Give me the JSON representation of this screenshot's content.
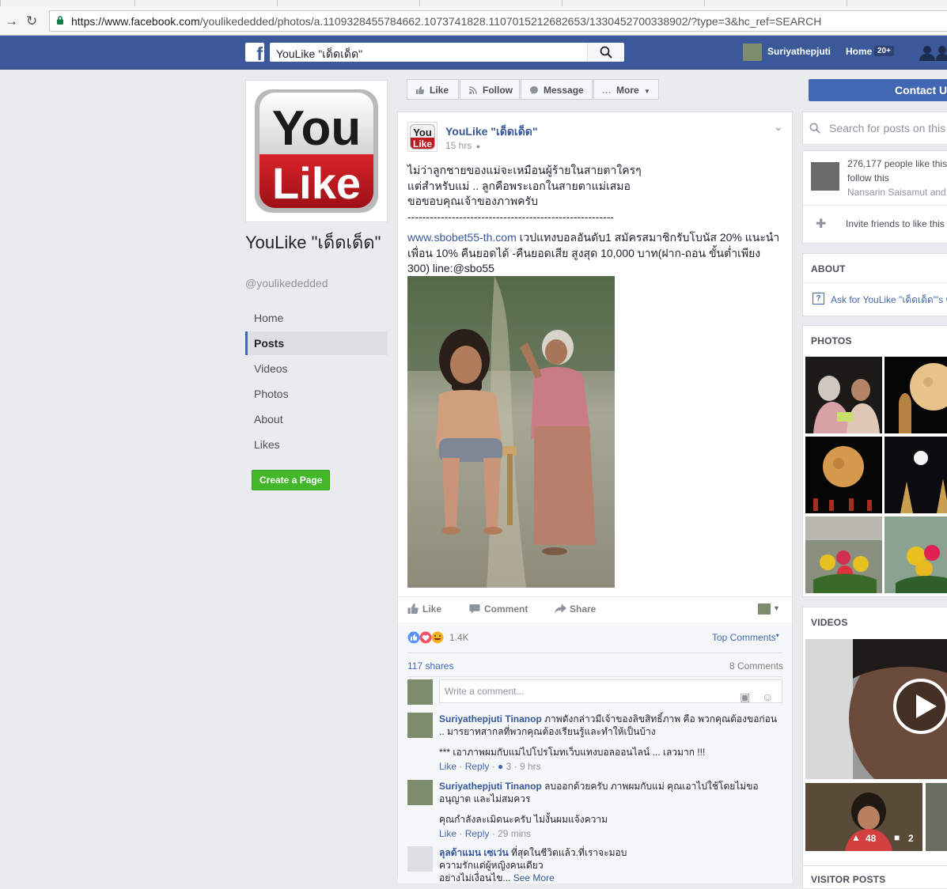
{
  "browser": {
    "url_host": "https://www.facebook.com",
    "url_path": "/youlikededded/photos/a.1109328455784662.1073741828.1107015212682653/1330452700338902/?type=3&hc_ref=SEARCH"
  },
  "topbar": {
    "search_value": "YouLike \"เด็ดเด็ด\"",
    "user_name": "Suriyathepjuti",
    "home_label": "Home",
    "home_badge": "20+"
  },
  "page": {
    "name": "YouLike \"เด็ดเด็ด\"",
    "handle": "@youlikededded",
    "logo_line1": "You",
    "logo_line2": "Like",
    "nav": [
      "Home",
      "Posts",
      "Videos",
      "Photos",
      "About",
      "Likes"
    ],
    "active_nav": "Posts",
    "create_page_label": "Create a Page"
  },
  "actions": {
    "like": "Like",
    "follow": "Follow",
    "message": "Message",
    "more": "More",
    "contact": "Contact Us"
  },
  "post": {
    "author": "YouLike \"เด็ดเด็ด\"",
    "time": "15 hrs",
    "text_lines": [
      "ไม่ว่าลูกชายของแม่จะเหมือนผู้ร้ายในสายตาใครๆ",
      "แต่สำหรับแม่ .. ลูกคือพระเอกในสายตาแม่เสมอ",
      "ขอขอบคุณเจ้าของภาพครับ",
      "--------------------------------------------------------"
    ],
    "link": "www.sbobet55-th.com",
    "promo_1": " เวปแทงบอลอันดับ1 สมัครสมาชิกรับโบนัส 20% แนะนำ",
    "promo_2": "เพื่อน 10% คืนยอดได้ -คืนยอดเสีย สูงสุด 10,000 บาท(ฝาก-ถอน ขั้นต่ำเพียง",
    "promo_3": "300) line:@sbo55",
    "buttons": {
      "like": "Like",
      "comment": "Comment",
      "share": "Share"
    },
    "reaction_count": "1.4K",
    "top_comments": "Top Comments",
    "shares": "117 shares",
    "comments_count": "8 Comments",
    "comment_placeholder": "Write a comment..."
  },
  "comments": [
    {
      "author": "Suriyathepjuti Tinanop",
      "text": " ภาพดังกล่าวมีเจ้าของลิขสิทธิ์ภาพ คือ พวกคุณต้องขอก่อน .. มารยาทสากลที่พวกคุณต้องเรียนรู้และทำให้เป็นบ้าง",
      "text2": "*** เอาภาพผมกับแม่ไปโปรโมทเว็บแทงบอลออนไลน์ ... เลวมาก !!!",
      "like": "Like",
      "reply": "Reply",
      "likes": "3",
      "time": "9 hrs"
    },
    {
      "author": "Suriyathepjuti Tinanop",
      "text": " ลบออกด้วยครับ ภาพผมกับแม่ คุณเอาไปใช้โดยไม่ขออนุญาต และไม่สมควร",
      "text2": "คุณกำลังละเมิดนะครับ ไม่งั้นผมแจ้งความ",
      "like": "Like",
      "reply": "Reply",
      "time": "29 mins"
    },
    {
      "author": "ลุลด้าแมน เซเว่น",
      "text": " ที่สุดในชีวิตแล้ว.ที่เราจะมอบ",
      "text2": "ความรักแด่ผู้หญิงคนเดียว",
      "text3": "อย่างไม่เงื่อนไข...",
      "see_more": "See More"
    }
  ],
  "right": {
    "search_placeholder": "Search for posts on this Page",
    "likes_text_1": "276,177 people like this and",
    "likes_text_2": "follow this",
    "likes_friends": "Nansarin Saisamut and",
    "invite": "Invite friends to like this Page",
    "about_heading": "ABOUT",
    "about_ask": "Ask for YouLike \"เด็ดเด็ด\"'s website",
    "photos_heading": "PHOTOS",
    "videos_heading": "VIDEOS",
    "video_likes": "48",
    "video_comments": "2",
    "visitor_heading": "VISITOR POSTS"
  },
  "colors": {
    "fb_blue": "#3b5998",
    "link": "#365899",
    "green": "#42b72a",
    "logo_red": "#c0181c"
  }
}
